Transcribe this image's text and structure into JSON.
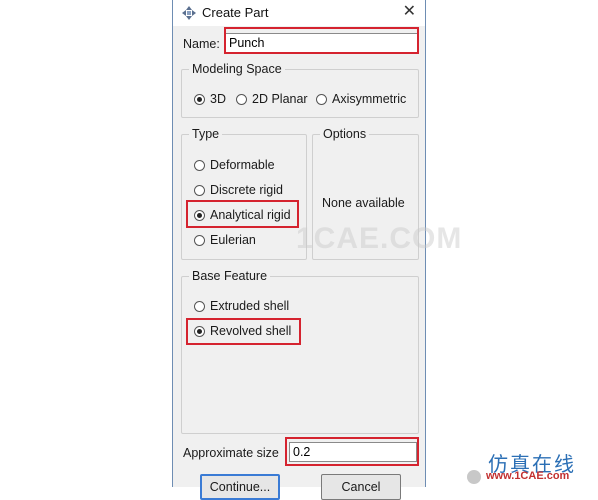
{
  "dialog": {
    "title": "Create Part",
    "name_label": "Name:",
    "name_value": "Punch",
    "modeling_space": {
      "title": "Modeling Space",
      "options": [
        "3D",
        "2D Planar",
        "Axisymmetric"
      ],
      "selected": "3D"
    },
    "type": {
      "title": "Type",
      "options": [
        "Deformable",
        "Discrete rigid",
        "Analytical rigid",
        "Eulerian"
      ],
      "selected": "Analytical rigid"
    },
    "options_group": {
      "title": "Options",
      "message": "None available"
    },
    "base_feature": {
      "title": "Base Feature",
      "options": [
        "Extruded shell",
        "Revolved shell"
      ],
      "selected": "Revolved shell"
    },
    "approx_size_label": "Approximate size",
    "approx_size_value": "0.2",
    "buttons": {
      "continue": "Continue...",
      "cancel": "Cancel"
    }
  },
  "watermarks": {
    "center": "1CAE.COM",
    "chinese": "仿真在线",
    "url": "www.1CAE.com"
  },
  "colors": {
    "highlight": "#d5232f",
    "accent": "#3a7bd5"
  },
  "icons": {
    "title": "abaqus-part-icon",
    "close": "close-icon"
  }
}
